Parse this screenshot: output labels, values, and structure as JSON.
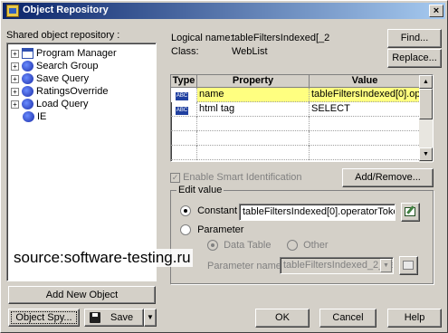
{
  "window": {
    "title": "Object Repository",
    "close_label": "×"
  },
  "left": {
    "shared_label": "Shared object repository :",
    "tree": [
      {
        "label": "Program Manager",
        "icon": "window-icon"
      },
      {
        "label": "Search Group",
        "icon": "browser-icon"
      },
      {
        "label": "Save Query",
        "icon": "browser-icon"
      },
      {
        "label": "RatingsOverride",
        "icon": "browser-icon"
      },
      {
        "label": "Load Query",
        "icon": "browser-icon"
      },
      {
        "label": "IE",
        "icon": "browser-icon"
      }
    ],
    "add_new_label": "Add New Object",
    "object_spy_label": "Object Spy...",
    "save_label": "Save",
    "save_dropdown_label": "▼"
  },
  "info": {
    "logical_name_label": "Logical name:",
    "logical_name_value": "tableFiltersIndexed[_2",
    "class_label": "Class:",
    "class_value": "WebList"
  },
  "buttons": {
    "find": "Find...",
    "replace": "Replace...",
    "add_remove": "Add/Remove...",
    "ok": "OK",
    "cancel": "Cancel",
    "help": "Help"
  },
  "grid": {
    "headers": [
      "Type",
      "Property",
      "Value"
    ],
    "rows": [
      {
        "type": "ABC",
        "property": "name",
        "value": "tableFiltersIndexed[0].operat"
      },
      {
        "type": "ABC",
        "property": "html tag",
        "value": "SELECT"
      }
    ]
  },
  "smart": {
    "label": "Enable Smart Identification"
  },
  "edit": {
    "title": "Edit value",
    "constant_label": "Constant",
    "constant_value": "tableFiltersIndexed[0].operatorToken",
    "parameter_label": "Parameter",
    "data_table_label": "Data Table",
    "other_label": "Other",
    "param_name_label": "Parameter name:",
    "param_name_value": "tableFiltersIndexed_2_na"
  },
  "watermark": "source:software-testing.ru",
  "colors": {
    "selected_row": "#ffff80",
    "title_start": "#0a246a",
    "title_end": "#a6caf0"
  }
}
